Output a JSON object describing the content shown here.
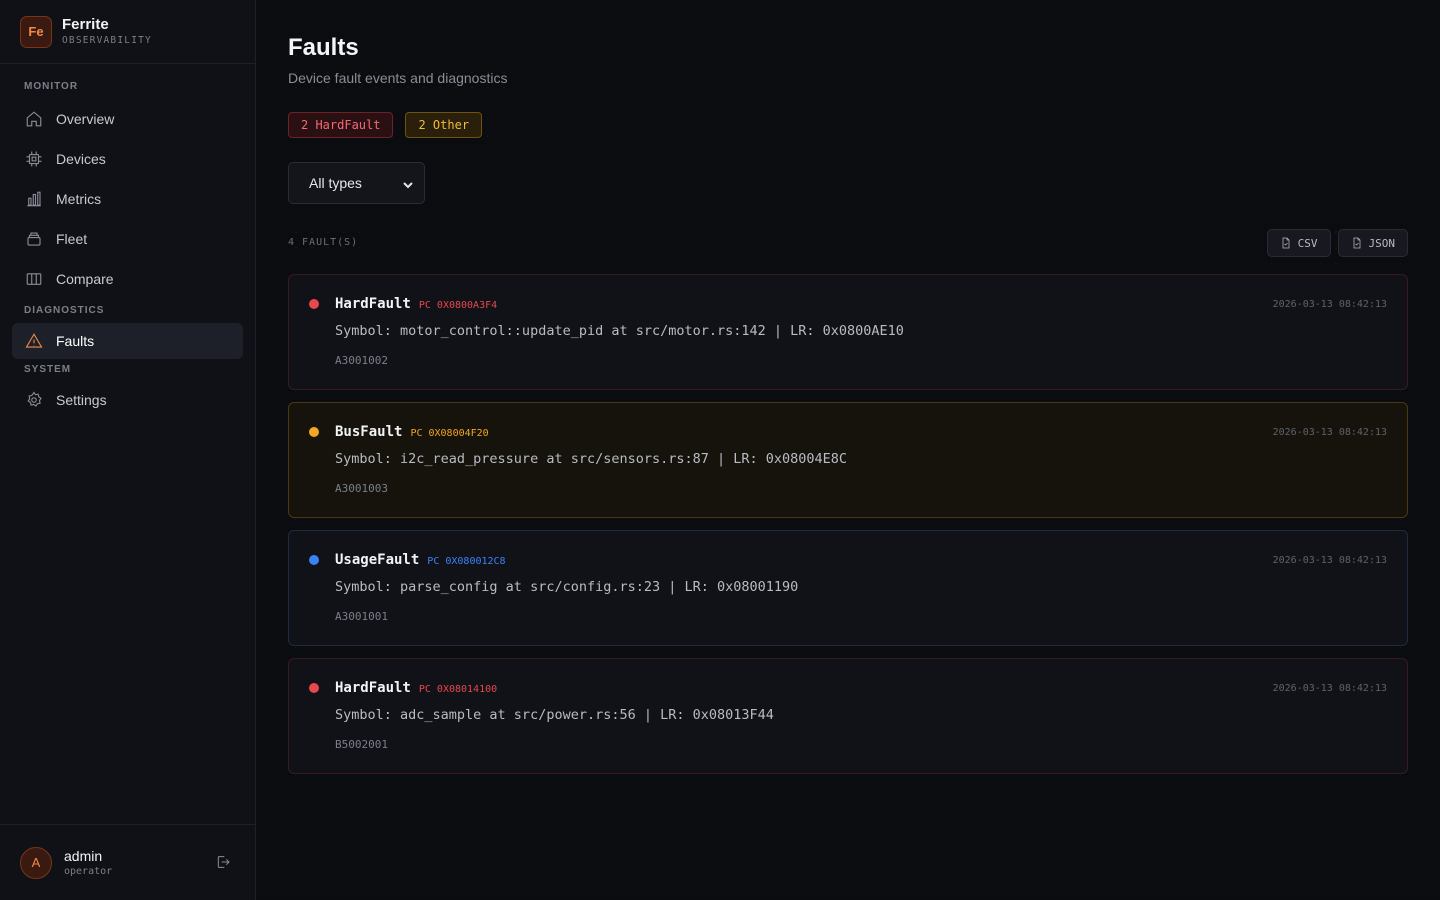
{
  "brand": {
    "logo": "Fe",
    "name": "Ferrite",
    "subtitle": "OBSERVABILITY"
  },
  "sidebar": {
    "sections": [
      {
        "label": "MONITOR",
        "items": [
          {
            "label": "Overview",
            "icon": "home-icon"
          },
          {
            "label": "Devices",
            "icon": "chip-icon"
          },
          {
            "label": "Metrics",
            "icon": "bar-chart-icon"
          },
          {
            "label": "Fleet",
            "icon": "layers-icon"
          },
          {
            "label": "Compare",
            "icon": "columns-icon"
          }
        ]
      },
      {
        "label": "DIAGNOSTICS",
        "items": [
          {
            "label": "Faults",
            "icon": "warning-icon",
            "active": true
          }
        ]
      },
      {
        "label": "SYSTEM",
        "items": [
          {
            "label": "Settings",
            "icon": "gear-icon"
          }
        ]
      }
    ]
  },
  "user": {
    "initial": "A",
    "name": "admin",
    "role": "operator",
    "logout_icon": "logout-icon"
  },
  "page": {
    "title": "Faults",
    "subtitle": "Device fault events and diagnostics",
    "summary": {
      "hard": "2 HardFault",
      "other": "2 Other"
    },
    "filter": {
      "selected": "All types"
    },
    "count_label": "4 FAULT(S)",
    "export": {
      "csv": "CSV",
      "json": "JSON"
    }
  },
  "colors": {
    "accent": "#f08a4b",
    "hardfault": "#e5484d",
    "busfault": "#f5a524",
    "usagefault": "#3b82f6"
  },
  "faults": [
    {
      "type": "HardFault",
      "pc": "PC 0X0800A3F4",
      "time": "2026-03-13 08:42:13",
      "symbol": "Symbol: motor_control::update_pid at src/motor.rs:142 | LR: 0x0800AE10",
      "device": "A3001002",
      "severity": "red"
    },
    {
      "type": "BusFault",
      "pc": "PC 0X08004F20",
      "time": "2026-03-13 08:42:13",
      "symbol": "Symbol: i2c_read_pressure at src/sensors.rs:87 | LR: 0x08004E8C",
      "device": "A3001003",
      "severity": "amber"
    },
    {
      "type": "UsageFault",
      "pc": "PC 0X080012C8",
      "time": "2026-03-13 08:42:13",
      "symbol": "Symbol: parse_config at src/config.rs:23 | LR: 0x08001190",
      "device": "A3001001",
      "severity": "blue"
    },
    {
      "type": "HardFault",
      "pc": "PC 0X08014100",
      "time": "2026-03-13 08:42:13",
      "symbol": "Symbol: adc_sample at src/power.rs:56 | LR: 0x08013F44",
      "device": "B5002001",
      "severity": "red"
    }
  ]
}
